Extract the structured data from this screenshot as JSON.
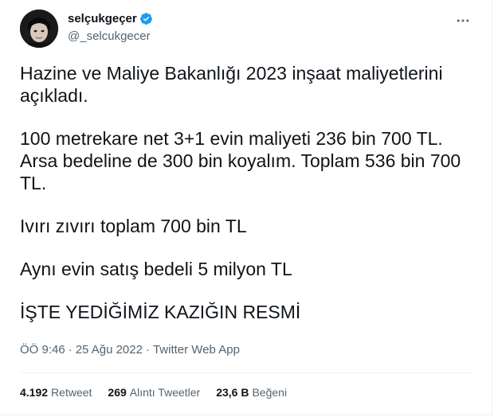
{
  "user": {
    "display_name": "selçukgeçer",
    "handle": "@_selcukgecer",
    "verified": true
  },
  "tweet": {
    "paragraphs": [
      "Hazine ve Maliye Bakanlığı 2023 inşaat maliyetlerini\naçıkladı.",
      "100 metrekare net 3+1 evin maliyeti 236 bin 700 TL.\nArsa bedeline de 300 bin koyalım. Toplam 536 bin 700\nTL.",
      "Ivırı zıvırı toplam 700 bin TL",
      "Aynı evin satış bedeli 5 milyon TL",
      "İŞTE YEDİĞİMİZ KAZIĞIN RESMİ"
    ]
  },
  "meta": {
    "time": "ÖÖ 9:46",
    "separator1": "·",
    "date": "25 Ağu 2022",
    "separator2": "·",
    "source": "Twitter Web App"
  },
  "stats": {
    "retweets_count": "4.192",
    "retweets_label": "Retweet",
    "quotes_count": "269",
    "quotes_label": "Alıntı Tweetler",
    "likes_count": "23,6 B",
    "likes_label": "Beğeni"
  },
  "colors": {
    "text": "#0f1419",
    "secondary": "#536471",
    "verified": "#1d9bf0",
    "border": "#eff3f4"
  },
  "icons": {
    "verified": "verified-badge-icon",
    "more": "more-horizontal-icon"
  }
}
